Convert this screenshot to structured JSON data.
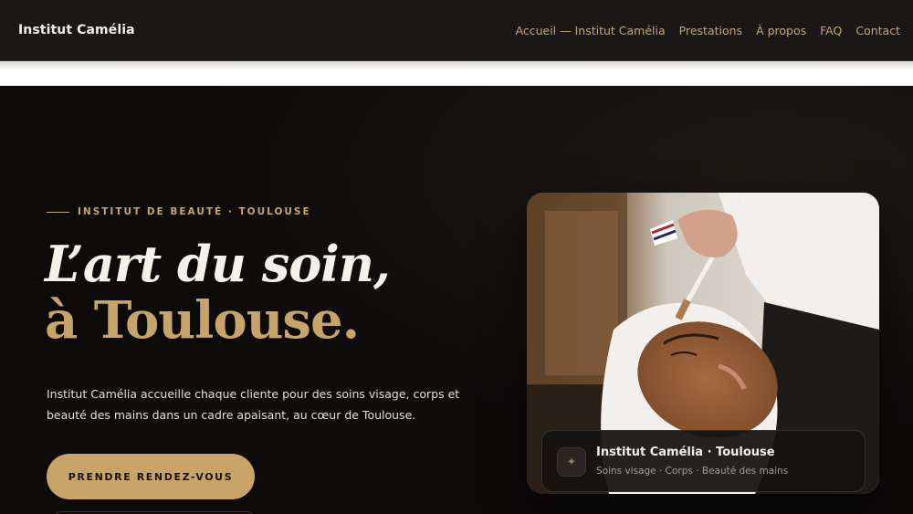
{
  "header": {
    "brand": "Institut Camélia",
    "nav": [
      {
        "label": "Accueil — Institut Camélia"
      },
      {
        "label": "Prestations"
      },
      {
        "label": "À propos"
      },
      {
        "label": "FAQ"
      },
      {
        "label": "Contact"
      }
    ]
  },
  "hero": {
    "eyebrow": "INSTITUT DE BEAUTÉ · TOULOUSE",
    "title_line1": "L’art du soin,",
    "title_line2": "à Toulouse.",
    "lead": "Institut Camélia accueille chaque cliente pour des soins visage, corps et beauté des mains dans un cadre apaisant, au cœur de Toulouse.",
    "cta_label": "PRENDRE RENDEZ-VOUS"
  },
  "card": {
    "icon": "sparkle-icon",
    "title": "Institut Camélia · Toulouse",
    "subtitle": "Soins visage · Corps · Beauté des mains"
  },
  "colors": {
    "accent": "#c7a56a",
    "background": "#0d0b0a",
    "nav_background": "#1a1817"
  }
}
